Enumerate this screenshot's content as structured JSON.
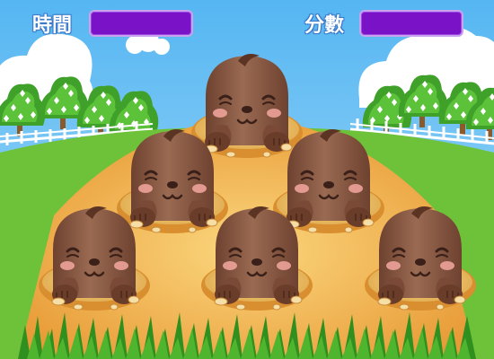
{
  "hud": {
    "time_label": "時間",
    "score_label": "分數"
  },
  "colors": {
    "sky": "#7cc6f0",
    "grass": "#6dc23a",
    "dirt": "#e9a845",
    "mole": "#8a5a44",
    "bar": "#7a12c8"
  },
  "moles": [
    {
      "id": "mole-top"
    },
    {
      "id": "mole-middle-left"
    },
    {
      "id": "mole-middle-right"
    },
    {
      "id": "mole-bottom-left"
    },
    {
      "id": "mole-bottom-center"
    },
    {
      "id": "mole-bottom-right"
    }
  ]
}
